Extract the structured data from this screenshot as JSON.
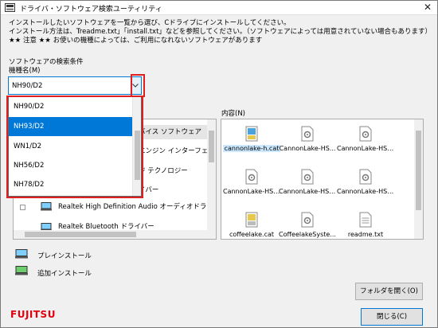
{
  "window": {
    "title": "ドライバ・ソフトウェア検索ユーティリティ"
  },
  "description": {
    "line1": "インストールしたいソフトウェアを一覧から選び、Cドライブにインストールしてください。",
    "line2": "インストール方法は、Treadme.txt」「install.txt」などを参照してください。（ソフトウェアによっては用意されていない場合もあります）",
    "line3": "★★ 注意 ★★ お使いの機種によっては、ご利用になれないソフトウェアがあります"
  },
  "search": {
    "condition_label": "ソフトウェアの検索条件",
    "model_label": "機種名(M)",
    "model_value": "NH90/D2",
    "model_options": [
      "NH90/D2",
      "NH93/D2",
      "WN1/D2",
      "NH56/D2",
      "NH78/D2"
    ],
    "selected_index": 1
  },
  "tree": {
    "items": [
      {
        "label": "バイス ソフトウェア"
      },
      {
        "label": "エンジン インターフェ"
      },
      {
        "label": "ジ テクノロジー"
      },
      {
        "label": "イバー"
      },
      {
        "label": "Realtek High Definition Audio オーディオドライバ"
      },
      {
        "label": "Realtek Bluetooth ドライバー"
      }
    ]
  },
  "contents": {
    "label": "内容(N)",
    "files": [
      {
        "name": "cannonlake-h.cat",
        "icon": "catalog-file-icon"
      },
      {
        "name": "CannonLake-HS...",
        "icon": "settings-file-icon"
      },
      {
        "name": "CannonLake-HSy...",
        "icon": "settings-file-icon"
      },
      {
        "name": "CannonLake-HSy...",
        "icon": "settings-file-icon"
      },
      {
        "name": "CannonLake-HSy...",
        "icon": "settings-file-icon"
      },
      {
        "name": "CannonLake-HSy...",
        "icon": "settings-file-icon"
      },
      {
        "name": "coffeelake.cat",
        "icon": "catalog-file-icon"
      },
      {
        "name": "CoffeelakeSyste...",
        "icon": "settings-file-icon"
      },
      {
        "name": "readme.txt",
        "icon": "text-file-icon"
      }
    ]
  },
  "legend": {
    "preinstall": "プレインストール",
    "additional": "追加インストール"
  },
  "buttons": {
    "open_folder": "フォルダを開く(O)",
    "close": "閉じる(C)"
  },
  "brand": {
    "logo_text": "FUJITSU",
    "logo_color": "#e2000f"
  },
  "colors": {
    "selection": "#0078d7",
    "highlight_box": "#e02020"
  }
}
